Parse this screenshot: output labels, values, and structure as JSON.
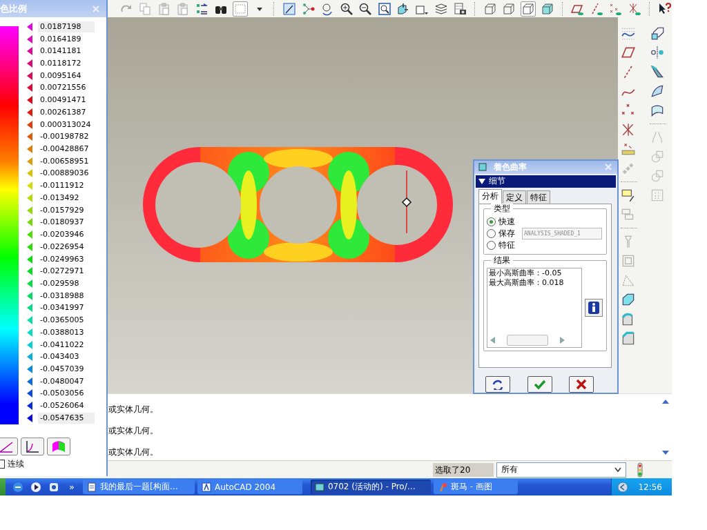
{
  "legend_panel": {
    "title": "色比例",
    "values": [
      {
        "text": "0.0187198",
        "kind": "field"
      },
      {
        "text": "0.0164189",
        "kind": "label"
      },
      {
        "text": "0.0141181",
        "kind": "label"
      },
      {
        "text": "0.0118172",
        "kind": "label"
      },
      {
        "text": "0.0095164",
        "kind": "label"
      },
      {
        "text": "0.00721556",
        "kind": "label"
      },
      {
        "text": "0.00491471",
        "kind": "label"
      },
      {
        "text": "0.00261387",
        "kind": "label"
      },
      {
        "text": "0.000313024",
        "kind": "label"
      },
      {
        "text": "-0.00198782",
        "kind": "label"
      },
      {
        "text": "-0.00428867",
        "kind": "label"
      },
      {
        "text": "-0.00658951",
        "kind": "label"
      },
      {
        "text": "-0.00889036",
        "kind": "label"
      },
      {
        "text": "-0.0111912",
        "kind": "label"
      },
      {
        "text": "-0.013492",
        "kind": "label"
      },
      {
        "text": "-0.0157929",
        "kind": "label"
      },
      {
        "text": "-0.0180937",
        "kind": "label"
      },
      {
        "text": "-0.0203946",
        "kind": "label"
      },
      {
        "text": "-0.0226954",
        "kind": "label"
      },
      {
        "text": "-0.0249963",
        "kind": "label"
      },
      {
        "text": "-0.0272971",
        "kind": "label"
      },
      {
        "text": "-0.029598",
        "kind": "label"
      },
      {
        "text": "-0.0318988",
        "kind": "label"
      },
      {
        "text": "-0.0341997",
        "kind": "label"
      },
      {
        "text": "-0.0365005",
        "kind": "label"
      },
      {
        "text": "-0.0388013",
        "kind": "label"
      },
      {
        "text": "-0.0411022",
        "kind": "label"
      },
      {
        "text": "-0.043403",
        "kind": "label"
      },
      {
        "text": "-0.0457039",
        "kind": "label"
      },
      {
        "text": "-0.0480047",
        "kind": "label"
      },
      {
        "text": "-0.0503056",
        "kind": "label"
      },
      {
        "text": "-0.0526064",
        "kind": "label"
      },
      {
        "text": "-0.0547635",
        "kind": "field"
      }
    ],
    "continuous": {
      "label": "连续",
      "checked": false
    }
  },
  "dialog": {
    "title": "着色曲率",
    "section": "细节",
    "tabs": [
      {
        "label": "分析",
        "selected": true
      },
      {
        "label": "定义",
        "selected": false
      },
      {
        "label": "特征",
        "selected": false
      }
    ],
    "type_group": {
      "title": "类型",
      "options": [
        {
          "label": "快速",
          "selected": true
        },
        {
          "label": "保存",
          "selected": false
        },
        {
          "label": "特征",
          "selected": false
        }
      ],
      "name_field": {
        "value": "ANALYSIS_SHADED_1",
        "disabled": true
      }
    },
    "results": {
      "title": "结果",
      "lines": [
        "最小高斯曲率：-0.05",
        "最大高斯曲率：0.018"
      ]
    }
  },
  "messages": [
    "或实体几何。",
    "或实体几何。",
    "或实体几何。"
  ],
  "status": {
    "selection": "选取了20",
    "filter": "所有"
  },
  "taskbar": {
    "more": "»",
    "items": [
      {
        "label": "我的最后一题[构面…",
        "selected": false
      },
      {
        "label": "AutoCAD 2004",
        "selected": false
      },
      {
        "label": "0702 (活动的) - Pro/…",
        "selected": true
      },
      {
        "label": "斑马 - 画图",
        "selected": false
      }
    ],
    "clock": "12:56"
  }
}
